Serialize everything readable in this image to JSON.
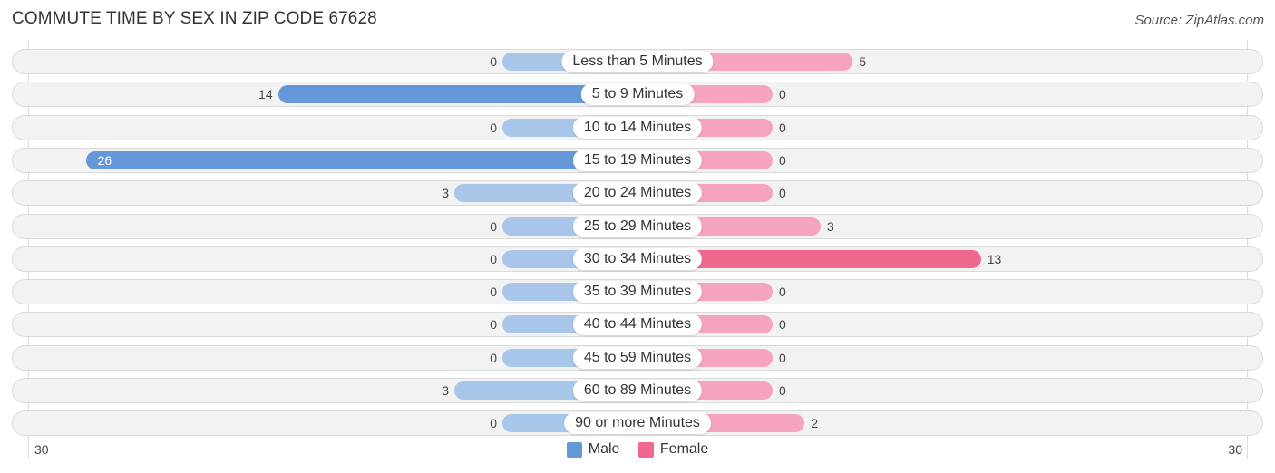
{
  "header": {
    "title": "COMMUTE TIME BY SEX IN ZIP CODE 67628",
    "source": "Source: ZipAtlas.com"
  },
  "colors": {
    "male": "#a8c6ea",
    "male_strong": "#6498d8",
    "female": "#f6a3bd",
    "female_strong": "#f06890"
  },
  "chart_data": {
    "type": "bar",
    "orientation": "horizontal-diverging",
    "title": "COMMUTE TIME BY SEX IN ZIP CODE 67628",
    "categories": [
      "Less than 5 Minutes",
      "5 to 9 Minutes",
      "10 to 14 Minutes",
      "15 to 19 Minutes",
      "20 to 24 Minutes",
      "25 to 29 Minutes",
      "30 to 34 Minutes",
      "35 to 39 Minutes",
      "40 to 44 Minutes",
      "45 to 59 Minutes",
      "60 to 89 Minutes",
      "90 or more Minutes"
    ],
    "series": [
      {
        "name": "Male",
        "values": [
          0,
          14,
          0,
          26,
          3,
          0,
          0,
          0,
          0,
          0,
          3,
          0
        ]
      },
      {
        "name": "Female",
        "values": [
          5,
          0,
          0,
          0,
          0,
          3,
          13,
          0,
          0,
          0,
          0,
          2
        ]
      }
    ],
    "axis": {
      "left_label": "30",
      "right_label": "30",
      "range": [
        0,
        30
      ]
    },
    "legend": {
      "position": "bottom-center",
      "entries": [
        "Male",
        "Female"
      ]
    }
  }
}
